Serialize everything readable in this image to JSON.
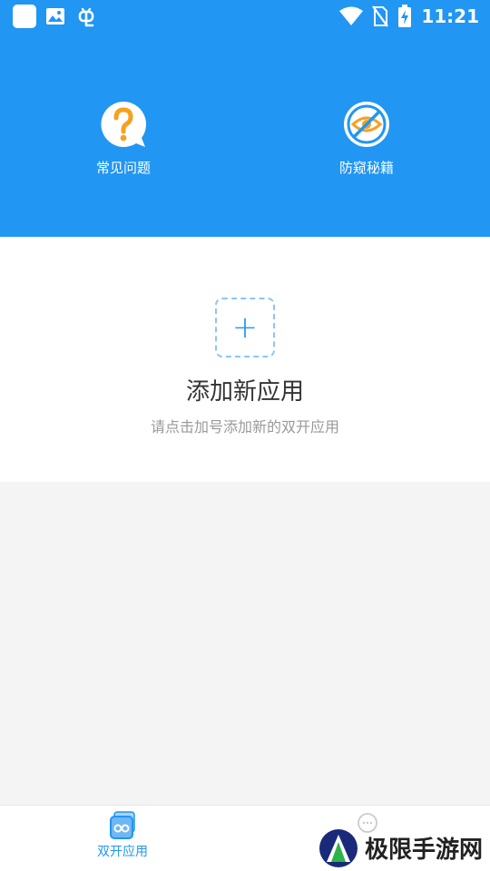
{
  "status_bar": {
    "time": "11:21",
    "icons": [
      "app-square-icon",
      "image-icon",
      "bug-icon",
      "wifi-icon",
      "no-sim-icon",
      "battery-charging-icon"
    ]
  },
  "hero": {
    "items": [
      {
        "label": "常见问题",
        "icon": "question-bubble-icon"
      },
      {
        "label": "防窥秘籍",
        "icon": "anti-peep-eye-icon"
      }
    ]
  },
  "add_app": {
    "button_icon": "plus-icon",
    "title": "添加新应用",
    "subtitle": "请点击加号添加新的双开应用"
  },
  "tabbar": {
    "tabs": [
      {
        "label": "双开应用",
        "icon": "dual-app-icon",
        "active": true
      },
      {
        "label": "",
        "icon": "chat-bubble-icon",
        "active": false
      }
    ]
  },
  "watermark": {
    "text": "极限手游网"
  },
  "colors": {
    "primary": "#2196f3",
    "accent": "#f7a020",
    "background": "#f4f4f4"
  }
}
